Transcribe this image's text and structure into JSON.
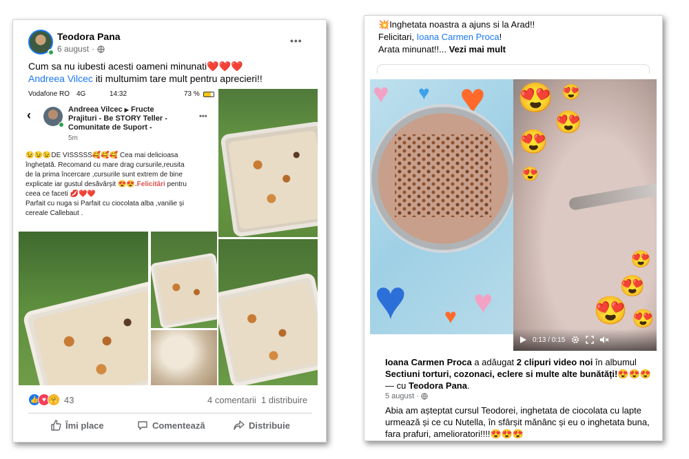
{
  "left_post": {
    "author": "Teodora Pana",
    "date": "6 august",
    "more": "•••",
    "text_line1": "Cum sa nu iubesti acesti oameni minunati",
    "emoji_hearts": "❤️❤️❤️",
    "mention": "Andreea Vilcec",
    "text_line2": " iti multumim tare mult pentru aprecieri!!",
    "reactions_count": "43",
    "comments": "4 comentarii",
    "shares": "1 distribuire",
    "actions": {
      "like": "Îmi place",
      "comment": "Comentează",
      "share": "Distribuie"
    },
    "screenshot": {
      "status_carrier": "Vodafone RO",
      "status_net": "4G",
      "status_time": "14:32",
      "status_battery": "73 %",
      "author_line1": "Andreea Vilcec",
      "arrow": "▶",
      "group_line1": "Fructe",
      "group_line2": "Prajituri - Be STORY Teller -",
      "group_line3": "Comunitate de Suport -",
      "time": "5m",
      "more": "•••",
      "body_emoji1": "😉😉😉",
      "body_l1": "DE VISSSSS",
      "body_emoji2": "🥰🥰🥰",
      "body_l1b": " Cea mai delicioasa",
      "body_l2": "înghețată. Recomand cu mare drag cursurile,reusita",
      "body_l3": "de la prima încercare ,cursurile sunt extrem de bine",
      "body_l4": "explicate iar gustul desăvârșit",
      "body_emoji3": "😍😍",
      "body_felicitari": ".Felicitări",
      "body_l4b": " pentru",
      "body_l5": "ceea ce faceti",
      "body_emoji4": "💋❤️❤️",
      "body_l6": "Parfait cu nuga si Parfait cu ciocolata alba ,vanilie și",
      "body_l7": "cereale Callebaut ."
    }
  },
  "right_post": {
    "line1_emoji": "💥",
    "line1": "Inghetata noastra a ajuns si la Arad!!",
    "congrats": "Felicitari, ",
    "congrats_mention": "Ioana Carmen Proca",
    "congrats_end": "!",
    "line3": "Arata minunat!!... ",
    "see_more": "Vezi mai mult",
    "video": {
      "time": "0:13 / 0:15"
    },
    "album_author": "Ioana Carmen Proca",
    "album_added": " a adăugat ",
    "album_count": "2 clipuri video noi",
    "album_in": " în albumul",
    "album_name": "Sectiuni torturi, cozonaci, eclere si multe alte bunătăți!",
    "album_emoji": "😍😍😍",
    "with_prefix": "— cu ",
    "with_name": "Teodora Pana",
    "with_end": ".",
    "date": "5 august",
    "body_l1": "Abia am așteptat cursul Teodorei, inghetata de ciocolata cu lapte",
    "body_l2": "urmează și ce cu Nutella, în sfârșit mănânc și eu o inghetata buna,",
    "body_l3": "fara prafuri, amelioratori!!!!",
    "body_emoji": "😍😍😍"
  }
}
